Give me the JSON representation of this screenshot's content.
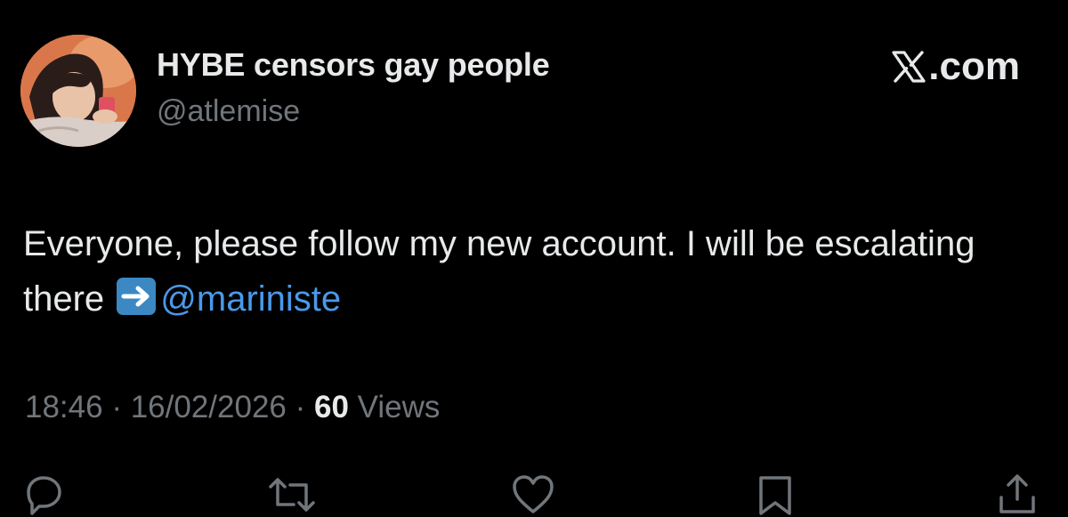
{
  "author": {
    "display_name": "HYBE censors gay people",
    "handle": "@atlemise"
  },
  "brand": {
    "label": ".com",
    "icon": "x-logo-icon"
  },
  "tweet": {
    "text_before": "Everyone, please follow my new account. I will be escalating there",
    "emoji": "right-arrow-emoji",
    "mention": "@mariniste"
  },
  "meta": {
    "time": "18:46",
    "sep1": " · ",
    "date": "16/02/2026",
    "sep2": " · ",
    "views_count": "60",
    "views_label": "Views"
  },
  "actions": [
    {
      "name": "reply",
      "icon": "reply-icon"
    },
    {
      "name": "repost",
      "icon": "repost-icon"
    },
    {
      "name": "like",
      "icon": "like-icon"
    },
    {
      "name": "bookmark",
      "icon": "bookmark-icon"
    },
    {
      "name": "share",
      "icon": "share-icon"
    }
  ],
  "colors": {
    "background": "#000000",
    "text": "#e7e9ea",
    "muted": "#71767b",
    "link": "#4a99e9"
  }
}
